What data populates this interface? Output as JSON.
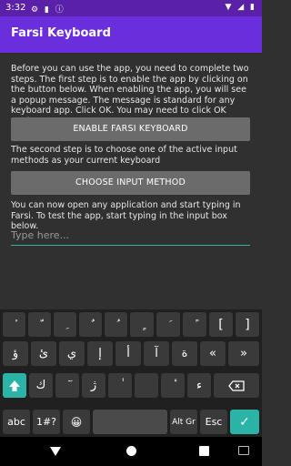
{
  "status_bar": {
    "time": "3:32",
    "left_icons": "⚙ ▮ ⓘ",
    "right_icons": "▼ ◢ ▮"
  },
  "app_bar": {
    "title": "Farsi Keyboard"
  },
  "content": {
    "paragraph1": "Before you can use the app, you need to complete two steps. The first step is to enable the app by clicking on the button below. When enabling the app, you will see a popup message. The message is standard for any keyboard app. Click OK. You may need to click OK again.",
    "enable_button": "ENABLE FARSI KEYBOARD",
    "paragraph2": "The second step is to choose one of the active input methods as your current keyboard",
    "choose_button": "CHOOSE INPUT METHOD",
    "paragraph3": "You can now open any application and start typing in Farsi. To test the app, start typing in the input box below.",
    "input_placeholder": "Type here..."
  },
  "keyboard": {
    "row1": [
      "ٔ",
      "ّ",
      "ِ",
      "ٌ",
      "ُ",
      "ٍ",
      "َ",
      "ً",
      "[",
      "]"
    ],
    "row2": [
      "ؤ",
      "ئ",
      "ي",
      "إ",
      "أ",
      "آ",
      "ة",
      "«",
      "»"
    ],
    "row3": [
      "ك",
      "ٓ",
      "ژ",
      "ٰ",
      "‌",
      "ٔ",
      "ء"
    ],
    "row4": {
      "abc": "abc",
      "sym": "1#?",
      "emoji": "😀",
      "altgr": "Alt Gr",
      "esc": "Esc",
      "enter": "✓"
    }
  },
  "colors": {
    "accent": "#2bb3a8",
    "app_bar": "#6a2edc",
    "status_bar": "#5b20a8"
  }
}
